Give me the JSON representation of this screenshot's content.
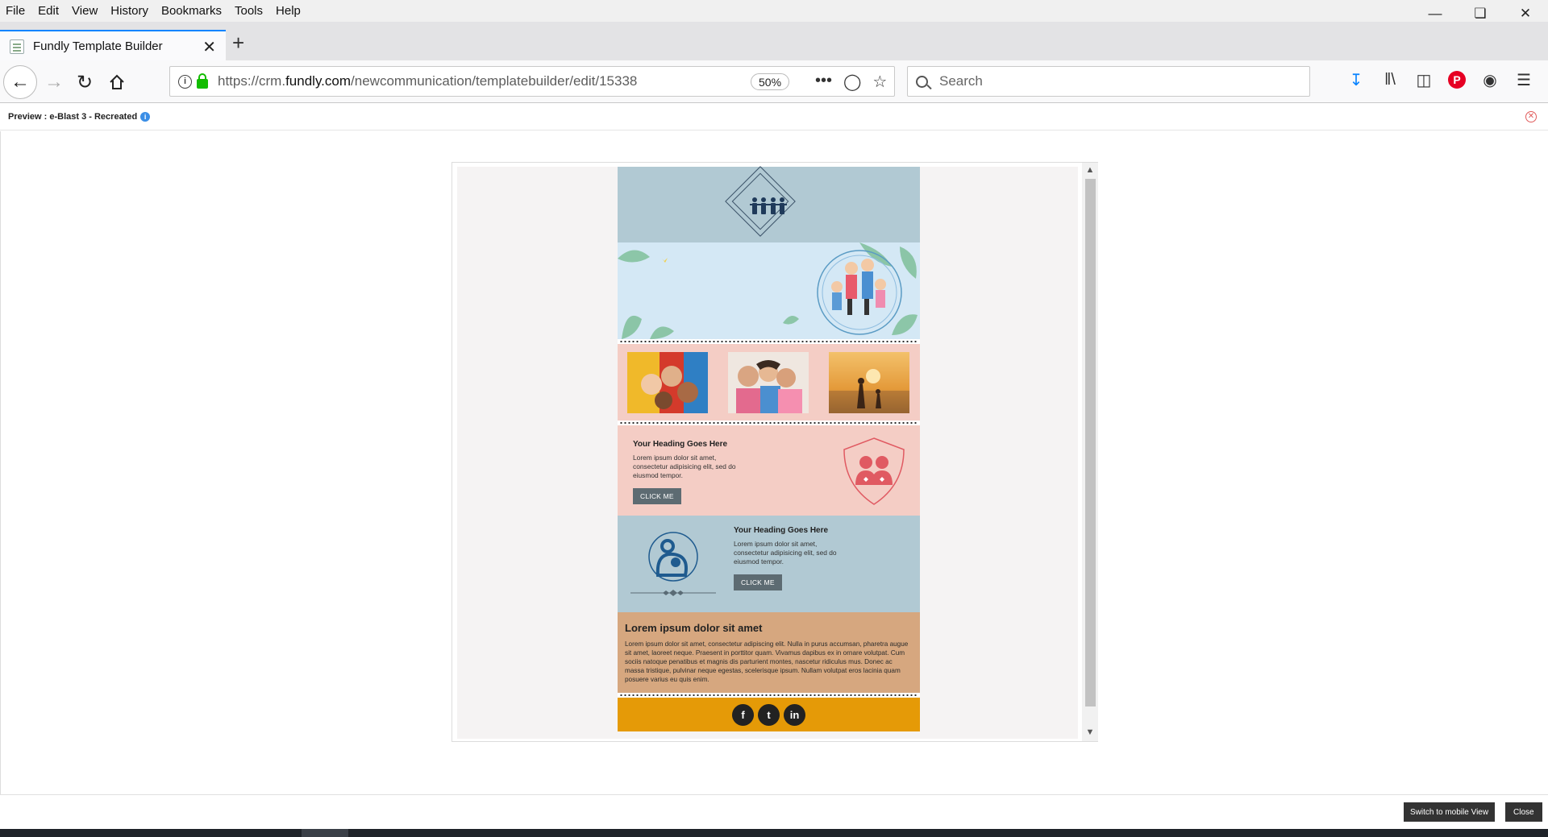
{
  "menubar": {
    "items": [
      "File",
      "Edit",
      "View",
      "History",
      "Bookmarks",
      "Tools",
      "Help"
    ]
  },
  "tab": {
    "title": "Fundly Template Builder"
  },
  "url": {
    "prefix": "https://crm.",
    "host": "fundly.com",
    "path": "/newcommunication/templatebuilder/edit/15338",
    "zoom": "50%"
  },
  "search": {
    "placeholder": "Search"
  },
  "preview": {
    "title": "Preview : e-Blast 3 - Recreated"
  },
  "email": {
    "block1": {
      "heading": "Your Heading Goes Here",
      "text": "Lorem ipsum dolor sit amet, consectetur adipisicing elit, sed do eiusmod tempor.",
      "button": "CLICK ME"
    },
    "block2": {
      "heading": "Your Heading Goes Here",
      "text": "Lorem ipsum dolor sit amet, consectetur adipisicing elit, sed do eiusmod tempor.",
      "button": "CLICK ME"
    },
    "article": {
      "heading": "Lorem ipsum dolor sit amet",
      "text": "Lorem ipsum dolor sit amet, consectetur adipiscing elit. Nulla in purus accumsan, pharetra augue sit amet, laoreet neque. Praesent in porttitor quam. Vivamus dapibus ex in ornare volutpat. Cum sociis natoque penatibus et magnis dis parturient montes, nascetur ridiculus mus. Donec ac massa tristique, pulvinar neque egestas, scelerisque ipsum. Nullam volutpat eros lacinia quam posuere varius eu quis enim."
    },
    "social": {
      "facebook": "f",
      "twitter": "t",
      "linkedin": "in"
    }
  },
  "footer": {
    "mobile_button": "Switch to mobile View",
    "close_button": "Close"
  },
  "colors": {
    "logo_bg": "#b1c9d3",
    "hero_bg": "#d4e8f5",
    "pink_bg": "#f4cdc5",
    "tan_bg": "#d6a77f",
    "social_bg": "#e59a07",
    "cta": "#5d6b72"
  }
}
